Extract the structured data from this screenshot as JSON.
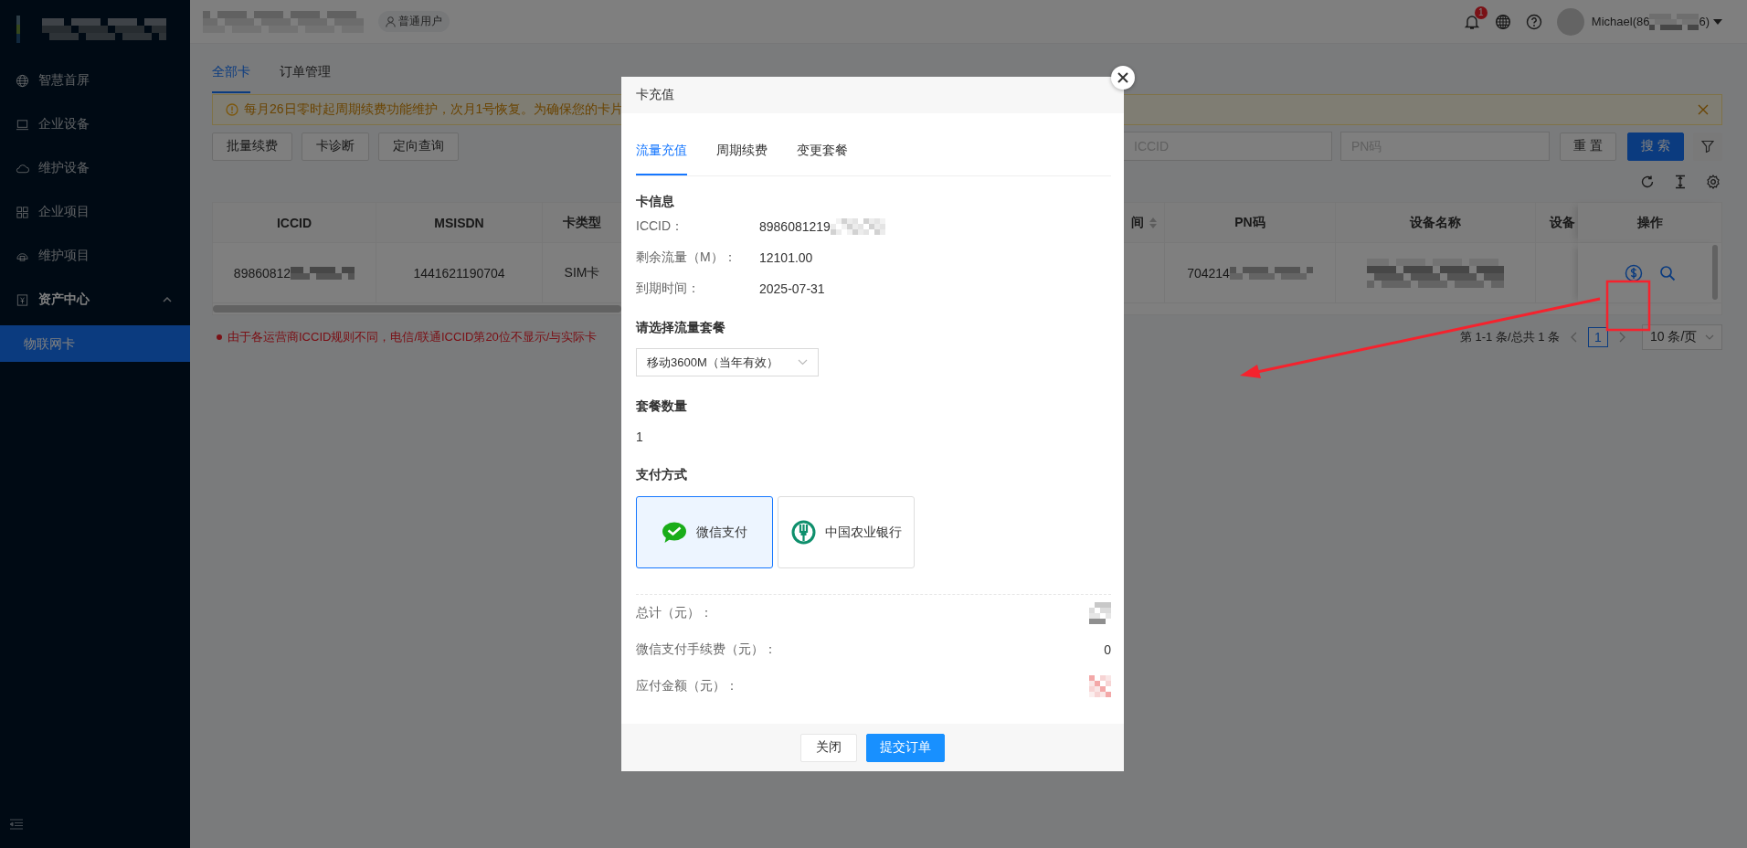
{
  "header": {
    "role_badge": "普通用户",
    "notification_count": "1",
    "user_name_start": "Michael(86",
    "user_name_end": "6)"
  },
  "sidebar": {
    "items": [
      {
        "label": "智慧首屏",
        "selected": false
      },
      {
        "label": "企业设备",
        "selected": false
      },
      {
        "label": "维护设备",
        "selected": false
      },
      {
        "label": "企业项目",
        "selected": false
      },
      {
        "label": "维护项目",
        "selected": false
      },
      {
        "label": "资产中心",
        "selected": false,
        "expanded": true,
        "children": [
          {
            "label": "物联网卡",
            "selected": true
          }
        ]
      }
    ]
  },
  "page_tabs": [
    {
      "label": "全部卡",
      "selected": true
    },
    {
      "label": "订单管理",
      "selected": false
    }
  ],
  "alert": {
    "text": "每月26日零时起周期续费功能维护，次月1号恢复。为确保您的卡片"
  },
  "action_buttons": [
    "批量续费",
    "卡诊断",
    "定向查询"
  ],
  "filters": [
    {
      "placeholder": "ICCID"
    },
    {
      "placeholder": "PN码"
    }
  ],
  "filter_buttons": [
    {
      "label": "重 置",
      "kind": "default"
    },
    {
      "label": "搜 索",
      "kind": "primary"
    }
  ],
  "table": {
    "left_columns": [
      "ICCID",
      "MSISDN",
      "卡类型"
    ],
    "right_columns": [
      "间",
      "PN码",
      "设备名称",
      "设备",
      "操作"
    ],
    "rows": [
      {
        "iccid": "89860812",
        "msisdn": "1441621190704",
        "card_type": "SIM卡",
        "pn_code": "704214"
      }
    ]
  },
  "note": "由于各运营商ICCID规则不同，电信/联通ICCID第20位不显示/与实际卡",
  "pagination": {
    "summary": "第 1-1 条/总共 1 条",
    "pages": [
      {
        "label": "1",
        "selected": true
      }
    ],
    "page_size": "10 条/页"
  },
  "dialog": {
    "title": "卡充值",
    "tabs": [
      {
        "label": "流量充值",
        "selected": true
      },
      {
        "label": "周期续费",
        "selected": false
      },
      {
        "label": "变更套餐",
        "selected": false
      }
    ],
    "card_info": {
      "heading": "卡信息",
      "fields": [
        {
          "label": "ICCID：",
          "value": "8986081219",
          "redacted_tail": true
        },
        {
          "label": "剩余流量（M）：",
          "value": "12101.00",
          "redacted_tail": false
        },
        {
          "label": "到期时间：",
          "value": "2025-07-31",
          "redacted_tail": false
        }
      ]
    },
    "package": {
      "heading": "请选择流量套餐",
      "value": "移动3600M（当年有效）"
    },
    "quantity": {
      "heading": "套餐数量",
      "value": "1"
    },
    "payment": {
      "heading": "支付方式",
      "methods": [
        {
          "label": "微信支付",
          "kind": "wechat",
          "selected": true
        },
        {
          "label": "中国农业银行",
          "kind": "bank",
          "selected": false
        }
      ]
    },
    "summary": [
      {
        "label": "总计（元）：",
        "kind": "redacted"
      },
      {
        "label": "微信支付手续费（元）：",
        "kind": "text",
        "value": "0"
      },
      {
        "label": "应付金额（元）：",
        "kind": "redacted"
      }
    ],
    "footer_buttons": [
      {
        "label": "关闭",
        "kind": "default"
      },
      {
        "label": "提交订单",
        "kind": "primary"
      }
    ]
  }
}
